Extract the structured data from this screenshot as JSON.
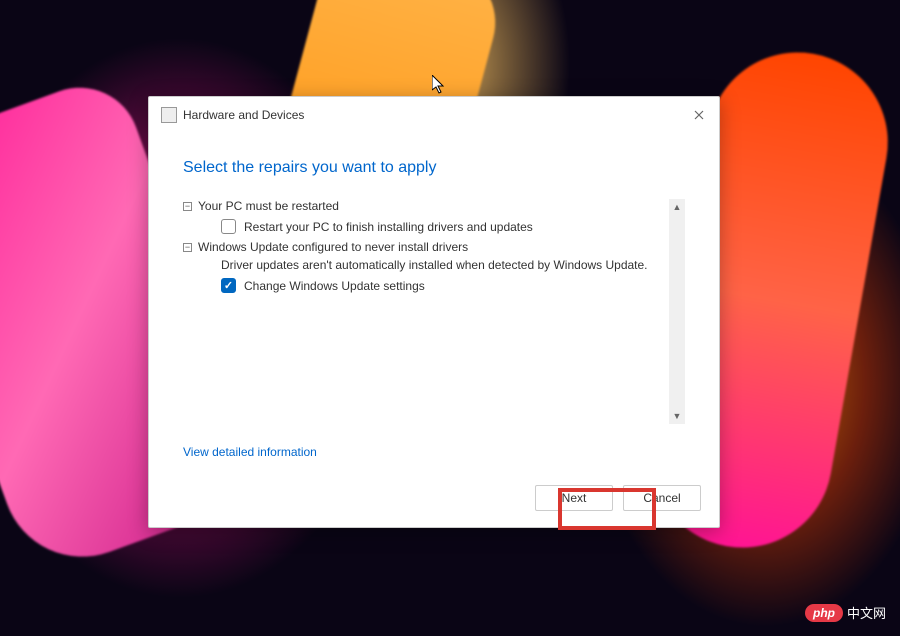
{
  "dialog": {
    "title": "Hardware and Devices",
    "heading": "Select the repairs you want to apply",
    "repairs": [
      {
        "title": "Your PC must be restarted",
        "checkbox_label": "Restart your PC to finish installing drivers and updates",
        "checked": false
      },
      {
        "title": "Windows Update configured to never install drivers",
        "description": "Driver updates aren't automatically installed when detected by Windows Update.",
        "checkbox_label": "Change Windows Update settings",
        "checked": true
      }
    ],
    "detail_link": "View detailed information",
    "buttons": {
      "next": "Next",
      "cancel": "Cancel"
    }
  },
  "watermark": {
    "badge": "php",
    "text": "中文网"
  }
}
